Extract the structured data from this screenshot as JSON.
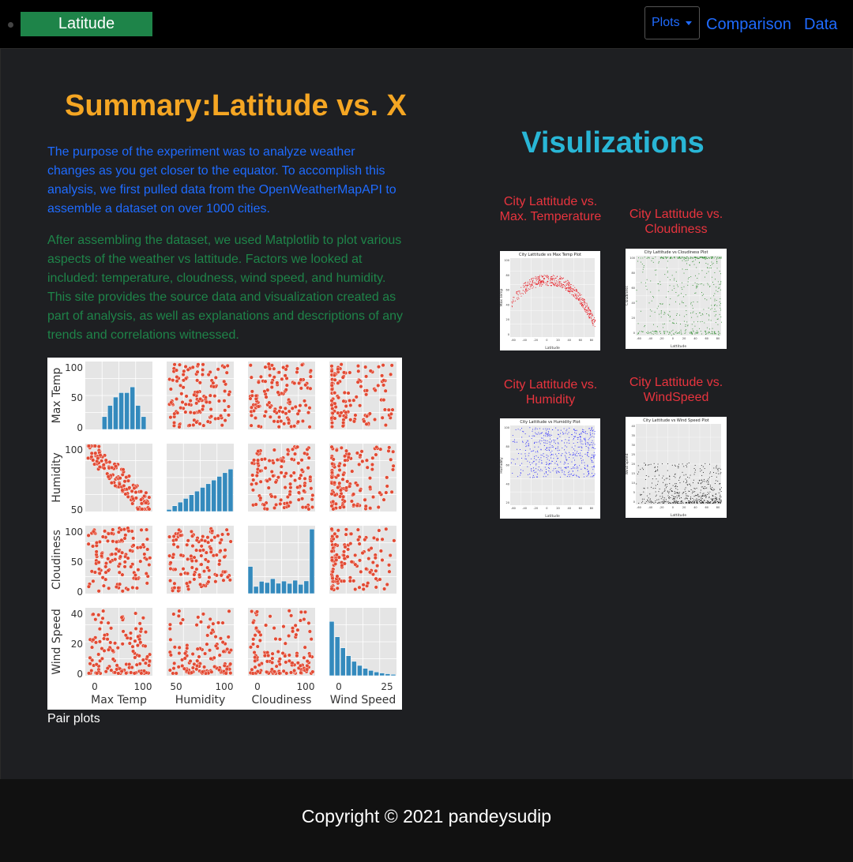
{
  "navbar": {
    "brand": "Latitude",
    "plots_label": "Plots",
    "comparison_label": "Comparison",
    "data_label": "Data"
  },
  "summary": {
    "title": "Summary:Latitude vs. X",
    "paragraph1": "The purpose of the experiment was to analyze weather changes as you get closer to the equator. To accomplish this analysis, we first pulled data from the OpenWeatherMapAPI to assemble a dataset on over 1000 cities.",
    "paragraph2": "After assembling the dataset, we used Matplotlib to plot various aspects of the weather vs lattitude. Factors we looked at included: temperature, cloudness, wind speed, and humidity. This site provides the source data and visualization created as part of analysis, as well as explanations and descriptions of any trends and correlations witnessed.",
    "pair_caption": "Pair plots"
  },
  "pairplot": {
    "variables": [
      "Max Temp",
      "Humidity",
      "Cloudiness",
      "Wind Speed"
    ],
    "y_ticks": [
      [
        "100",
        "50",
        "0"
      ],
      [
        "100",
        "50"
      ],
      [
        "100",
        "50",
        "0"
      ],
      [
        "40",
        "20",
        "0"
      ]
    ],
    "x_ticks": [
      [
        "0",
        "100"
      ],
      [
        "50",
        "100"
      ],
      [
        "0",
        "100"
      ],
      [
        "0",
        "25"
      ]
    ],
    "scatter_color": "#e24a33",
    "hist_color": "#348abd"
  },
  "visualizations": {
    "title": "Visulizations",
    "plots": [
      {
        "title": "City Lattitude vs. Max. Temperature",
        "chart_title": "City Lattitude vs Max Temp Plot",
        "ylabel": "Max Temp",
        "xlabel": "Latitude",
        "color": "#e8141c",
        "x_ticks": [
          "-60",
          "-40",
          "-20",
          "0",
          "20",
          "40",
          "60",
          "80"
        ],
        "y_ticks": [
          "100",
          "80",
          "60",
          "40",
          "20",
          "0"
        ]
      },
      {
        "title": "City Lattitude vs. Cloudiness",
        "chart_title": "City Lattitude vs Cloudiness Plot",
        "ylabel": "Cloudiness",
        "xlabel": "Lattitude",
        "color": "#2a8a2a",
        "x_ticks": [
          "-60",
          "-40",
          "-20",
          "0",
          "20",
          "40",
          "60",
          "80"
        ],
        "y_ticks": [
          "100",
          "80",
          "60",
          "40",
          "20",
          "0"
        ]
      },
      {
        "title": "City Lattitude vs. Humidity",
        "chart_title": "City Lattitude vs Humidity Plot",
        "ylabel": "Humidity",
        "xlabel": "Latitude",
        "color": "#1a1aff",
        "x_ticks": [
          "-60",
          "-40",
          "-20",
          "0",
          "20",
          "40",
          "60",
          "80"
        ],
        "y_ticks": [
          "100",
          "80",
          "60",
          "40",
          "20"
        ]
      },
      {
        "title": "City Lattitude vs. WindSpeed",
        "chart_title": "City Lattitude vs Wind Speed Plot",
        "ylabel": "Wind Speed",
        "xlabel": "Lattitude",
        "color": "#111111",
        "x_ticks": [
          "-60",
          "-40",
          "-20",
          "0",
          "20",
          "40",
          "60",
          "80"
        ],
        "y_ticks": [
          "40",
          "35",
          "30",
          "25",
          "20",
          "15",
          "10",
          "5",
          "0"
        ]
      }
    ]
  },
  "footer": {
    "copyright": "Copyright © 2021 pandeysudip"
  }
}
